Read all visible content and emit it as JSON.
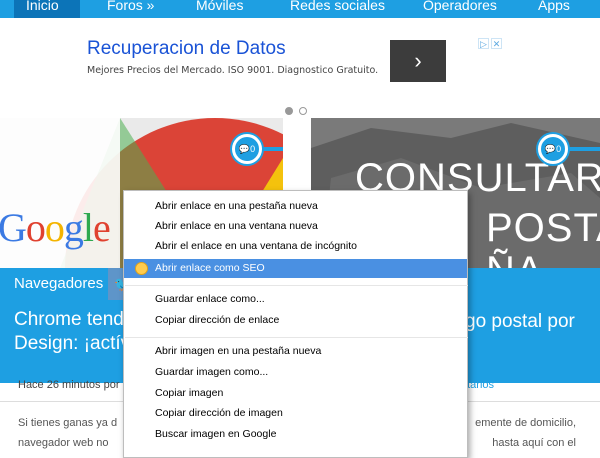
{
  "nav": {
    "items": [
      {
        "label": "Inicio",
        "active": true
      },
      {
        "label": "Foros »",
        "active": false
      },
      {
        "label": "Móviles",
        "active": false
      },
      {
        "label": "Redes sociales",
        "active": false
      },
      {
        "label": "Operadores",
        "active": false
      },
      {
        "label": "Apps",
        "active": false
      }
    ]
  },
  "ad": {
    "title": "Recuperacion de Datos",
    "description": "Mejores Precios del Mercado. ISO 9001. Diagnostico Gratuito.",
    "arrow": "›",
    "choices": [
      "▷",
      "✕"
    ]
  },
  "cards": {
    "left": {
      "image_text": [
        "G",
        "o",
        "o",
        "g",
        "l",
        "e"
      ],
      "comments": "0",
      "category": "Navegadores",
      "share_icon": "twitter",
      "title_lines": [
        "Chrome tendrá",
        "Design: ¡actíval"
      ],
      "meta": "Hace 26 minutos por",
      "excerpt_lines": [
        "Si tienes ganas ya d",
        "navegador web no",
        "..."
      ]
    },
    "right": {
      "image_lines": [
        "CONSULTAR",
        "POSTAL",
        "ÑA"
      ],
      "comments": "0",
      "title": "go postal por",
      "meta": "ntarios",
      "excerpt_lines": [
        "emente de domicilio,",
        "hasta aquí con el"
      ]
    }
  },
  "context_menu": {
    "items": [
      "Abrir enlace en una pestaña nueva",
      "Abrir enlace en una ventana nueva",
      "Abrir el enlace en una ventana de incógnito",
      "Abrir enlace como SEO",
      "Guardar enlace como...",
      "Copiar dirección de enlace",
      "Abrir imagen en una pestaña nueva",
      "Guardar imagen como...",
      "Copiar imagen",
      "Copiar dirección de imagen",
      "Buscar imagen en Google"
    ],
    "highlighted_index": 3
  },
  "colors": {
    "brand": "#1e9fe2",
    "nav_active": "#0c74b8",
    "menu_highlight": "#4a90e2"
  }
}
